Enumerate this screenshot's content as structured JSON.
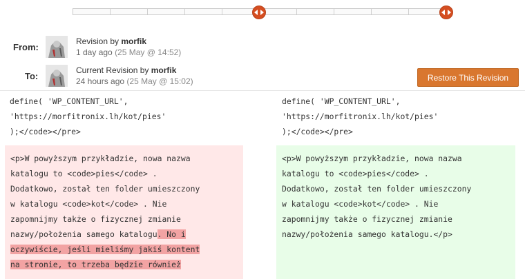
{
  "revision_slider": {
    "tick_count": 10,
    "from_handle_icon": "left-right-arrows-icon",
    "to_handle_icon": "left-right-arrows-icon"
  },
  "from": {
    "label": "From:",
    "prefix": "Revision by",
    "author": "morfik",
    "time_ago": "1 day ago",
    "date": "(25 May @ 14:52)"
  },
  "to": {
    "label": "To:",
    "prefix": "Current Revision by",
    "author": "morfik",
    "time_ago": "24 hours ago",
    "date": "(25 May @ 15:02)"
  },
  "restore_button": "Restore This Revision",
  "colors": {
    "accent": "#d9772f",
    "deleted_bg": "#ffe8e8",
    "added_bg": "#e8fde8",
    "highlight": "#f2a3a3"
  },
  "diff": {
    "left_context": [
      "define( 'WP_CONTENT_URL',",
      "'https://morfitronix.lh/kot/pies'",
      ");</code></pre>"
    ],
    "right_context": [
      "define( 'WP_CONTENT_URL',",
      "'https://morfitronix.lh/kot/pies'",
      ");</code></pre>"
    ],
    "deleted_lines": [
      "<p>W powyższym przykładzie, nowa nazwa",
      "katalogu to <code>pies</code> .",
      "Dodatkowo, został ten folder umieszczony",
      "w katalogu <code>kot</code> . Nie",
      "zapomnijmy także o fizycznej zmianie"
    ],
    "deleted_line6_plain": "nazwy/położenia samego katalogu",
    "deleted_line6_hl": ". No i",
    "deleted_line7_hl": "oczywiście, jeśli mieliśmy jakiś kontent",
    "deleted_line8_hl": "na stronie, to trzeba będzie również",
    "added_lines": [
      "<p>W powyższym przykładzie, nowa nazwa",
      "katalogu to <code>pies</code> .",
      "Dodatkowo, został ten folder umieszczony",
      "w katalogu <code>kot</code> . Nie",
      "zapomnijmy także o fizycznej zmianie",
      "nazwy/położenia samego katalogu.</p>"
    ]
  }
}
